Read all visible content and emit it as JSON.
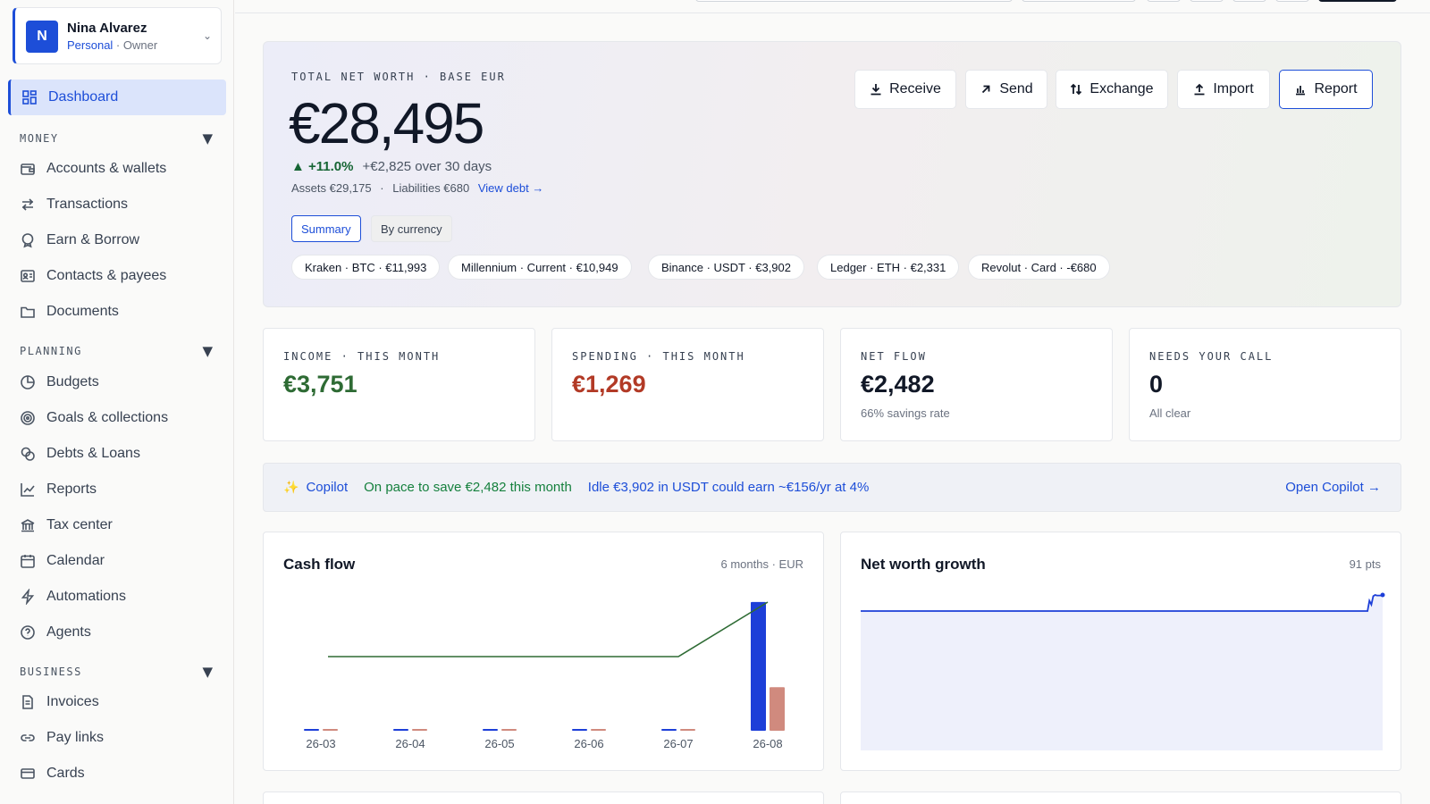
{
  "account": {
    "initial": "N",
    "name": "Nina Alvarez",
    "type": "Personal",
    "role_sep": " · ",
    "role": "Owner"
  },
  "nav": {
    "dashboard": "Dashboard",
    "sections": {
      "money": "MONEY",
      "planning": "PLANNING",
      "business": "BUSINESS"
    },
    "money_items": [
      "Accounts & wallets",
      "Transactions",
      "Earn & Borrow",
      "Contacts & payees",
      "Documents"
    ],
    "planning_items": [
      "Budgets",
      "Goals & collections",
      "Debts & Loans",
      "Reports",
      "Tax center",
      "Calendar",
      "Automations",
      "Agents"
    ],
    "business_items": [
      "Invoices",
      "Pay links",
      "Cards"
    ]
  },
  "hero": {
    "label": "TOTAL NET WORTH · BASE EUR",
    "value": "€28,495",
    "change": "▲ +11.0%",
    "change_period": "+€2,825 over 30 days",
    "assets": "Assets €29,175",
    "sep": "·",
    "liabilities": "Liabilities €680",
    "debt_link": "View debt →",
    "toggles": [
      "Summary",
      "By currency"
    ],
    "pills": [
      "Kraken · BTC · €11,993",
      "Millennium · Current · €10,949",
      "Binance · USDT · €3,902",
      "Ledger · ETH · €2,331",
      "Revolut · Card · -€680"
    ],
    "actions": [
      "Receive",
      "Send",
      "Exchange",
      "Import",
      "Report"
    ]
  },
  "stats": [
    {
      "label": "INCOME · THIS MONTH",
      "value": "€3,751",
      "sub": "",
      "color": "#2e6b34"
    },
    {
      "label": "SPENDING · THIS MONTH",
      "value": "€1,269",
      "sub": "",
      "color": "#b23a26"
    },
    {
      "label": "NET FLOW",
      "value": "€2,482",
      "sub": "66% savings rate",
      "color": "#111827"
    },
    {
      "label": "NEEDS YOUR CALL",
      "value": "0",
      "sub": "All clear",
      "color": "#111827"
    }
  ],
  "copilot": {
    "title": "Copilot",
    "message_1": "On pace to save €2,482 this month",
    "message_2": "Idle €3,902 in USDT could earn ~€156/yr at 4%",
    "open": "Open Copilot →"
  },
  "cashflow": {
    "title": "Cash flow",
    "meta": "6 months · EUR"
  },
  "networth": {
    "title": "Net worth growth",
    "meta": "91 pts"
  },
  "chart_data": [
    {
      "type": "bar",
      "title": "Cash flow",
      "categories": [
        "26-03",
        "26-04",
        "26-05",
        "26-06",
        "26-07",
        "26-08"
      ],
      "series": [
        {
          "values": [
            0,
            0,
            0,
            0,
            0,
            3751
          ],
          "color": "#1d3fd8"
        },
        {
          "values": [
            0,
            0,
            0,
            0,
            0,
            1269
          ],
          "color": "#d08a7e"
        }
      ],
      "line": {
        "values": [
          0,
          0,
          0,
          0,
          0,
          2482
        ],
        "color": "#2e6b34"
      },
      "ylim": [
        -1300,
        3800
      ]
    },
    {
      "type": "area",
      "title": "Net worth growth",
      "points": 91,
      "values_sampled": [
        25670,
        25670,
        25670,
        25670,
        25670,
        25670,
        25670,
        25670,
        25670,
        25670,
        25670,
        25670,
        25670,
        25670,
        25670,
        25670,
        25670,
        25670,
        25670,
        25670,
        25670,
        25670,
        25670,
        25670,
        25670,
        25670,
        25670,
        25670,
        25670,
        25670,
        25670,
        25670,
        25670,
        25670,
        25670,
        25670,
        25670,
        25670,
        25670,
        25670,
        25670,
        25670,
        25670,
        25670,
        25670,
        25670,
        25670,
        25670,
        25670,
        25670,
        25670,
        25670,
        25670,
        25670,
        25670,
        25670,
        25670,
        25670,
        25670,
        25670,
        25670,
        25670,
        25670,
        25670,
        25670,
        25670,
        25670,
        25670,
        25670,
        25670,
        25670,
        25670,
        25670,
        25670,
        25670,
        25670,
        25670,
        25670,
        25670,
        25670,
        25670,
        25670,
        25670,
        25670,
        25670,
        25670,
        25670,
        25670,
        25670,
        25670,
        25670,
        25670,
        25670,
        25670,
        25670,
        25670,
        25670,
        25670,
        25670,
        25670,
        25670,
        25670,
        25670,
        25670,
        25670,
        25670,
        25670,
        25670,
        25670,
        25670,
        25670,
        25670,
        25670,
        25670,
        25670,
        25670,
        25670,
        25670,
        25670,
        25670,
        25670,
        25670,
        25670,
        25670,
        25670,
        25670,
        25670,
        25670,
        25670,
        25670,
        25670,
        25670,
        25670,
        25670,
        25670,
        25670,
        25670,
        25670,
        25670,
        25670,
        25670,
        25670,
        25670,
        25670,
        25670,
        25670,
        25670,
        25670,
        25670,
        25670,
        25670,
        25670,
        25670,
        25670,
        25670,
        25670,
        25670,
        25670,
        25670,
        25670,
        25670,
        25670,
        25670,
        25670,
        25670,
        25670,
        25670,
        25670,
        25670,
        25670,
        25670,
        25670,
        25670,
        25670,
        25670,
        25670,
        25670,
        25670,
        25670,
        25670,
        25670,
        25670,
        25670,
        25670,
        25670,
        25670,
        25670,
        25670,
        25670,
        25670,
        25670,
        25670,
        25670,
        25670,
        25670,
        25670,
        25670,
        25670,
        25670,
        25670,
        25670,
        25670,
        25670,
        25670,
        25670,
        25670,
        25670,
        25670,
        25670,
        25670,
        25670,
        25670,
        25670,
        25670,
        25670,
        25670,
        25670,
        25670,
        25670,
        25670,
        25670,
        25670,
        25670,
        25670,
        25670,
        25670,
        25670,
        25670,
        25670,
        25670,
        25670,
        25670,
        25670,
        25670,
        25670,
        25670,
        25670,
        25670,
        25670,
        25670,
        25670,
        25670,
        25670,
        25670,
        25670,
        25670,
        25670,
        25670,
        25670,
        25670,
        25670,
        25670,
        25670,
        25670,
        25670,
        25670,
        25670,
        25670,
        25670,
        25670,
        25670,
        25670,
        25670,
        25670,
        25670,
        25670,
        25670,
        25670,
        25670,
        25670,
        27500,
        26800,
        28300,
        28500,
        28400,
        28400,
        28400,
        28495
      ],
      "line_color": "#1d3fd8",
      "fill_color": "#eef0fb"
    }
  ]
}
